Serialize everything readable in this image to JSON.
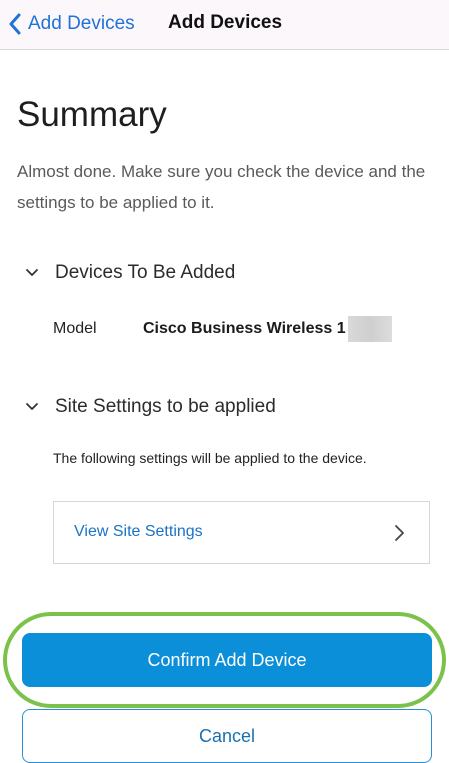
{
  "nav": {
    "back_label": "Add Devices",
    "title": "Add Devices",
    "back_icon": "chevron-left-icon"
  },
  "page": {
    "title": "Summary",
    "intro": "Almost done. Make sure you check the device and the settings to be applied to it."
  },
  "devices_section": {
    "header": "Devices To Be Added",
    "toggle_icon": "chevron-down-icon",
    "model_key": "Model",
    "model_value": "Cisco Business Wireless 1"
  },
  "site_section": {
    "header": "Site Settings to be applied",
    "toggle_icon": "chevron-down-icon",
    "description": "The following settings will be applied to the device.",
    "view_link": "View Site Settings",
    "view_icon": "chevron-right-icon"
  },
  "actions": {
    "confirm_label": "Confirm Add Device",
    "cancel_label": "Cancel"
  },
  "colors": {
    "accent": "#0a8fd8",
    "link": "#1a73c8",
    "highlight": "#7cc24a"
  }
}
